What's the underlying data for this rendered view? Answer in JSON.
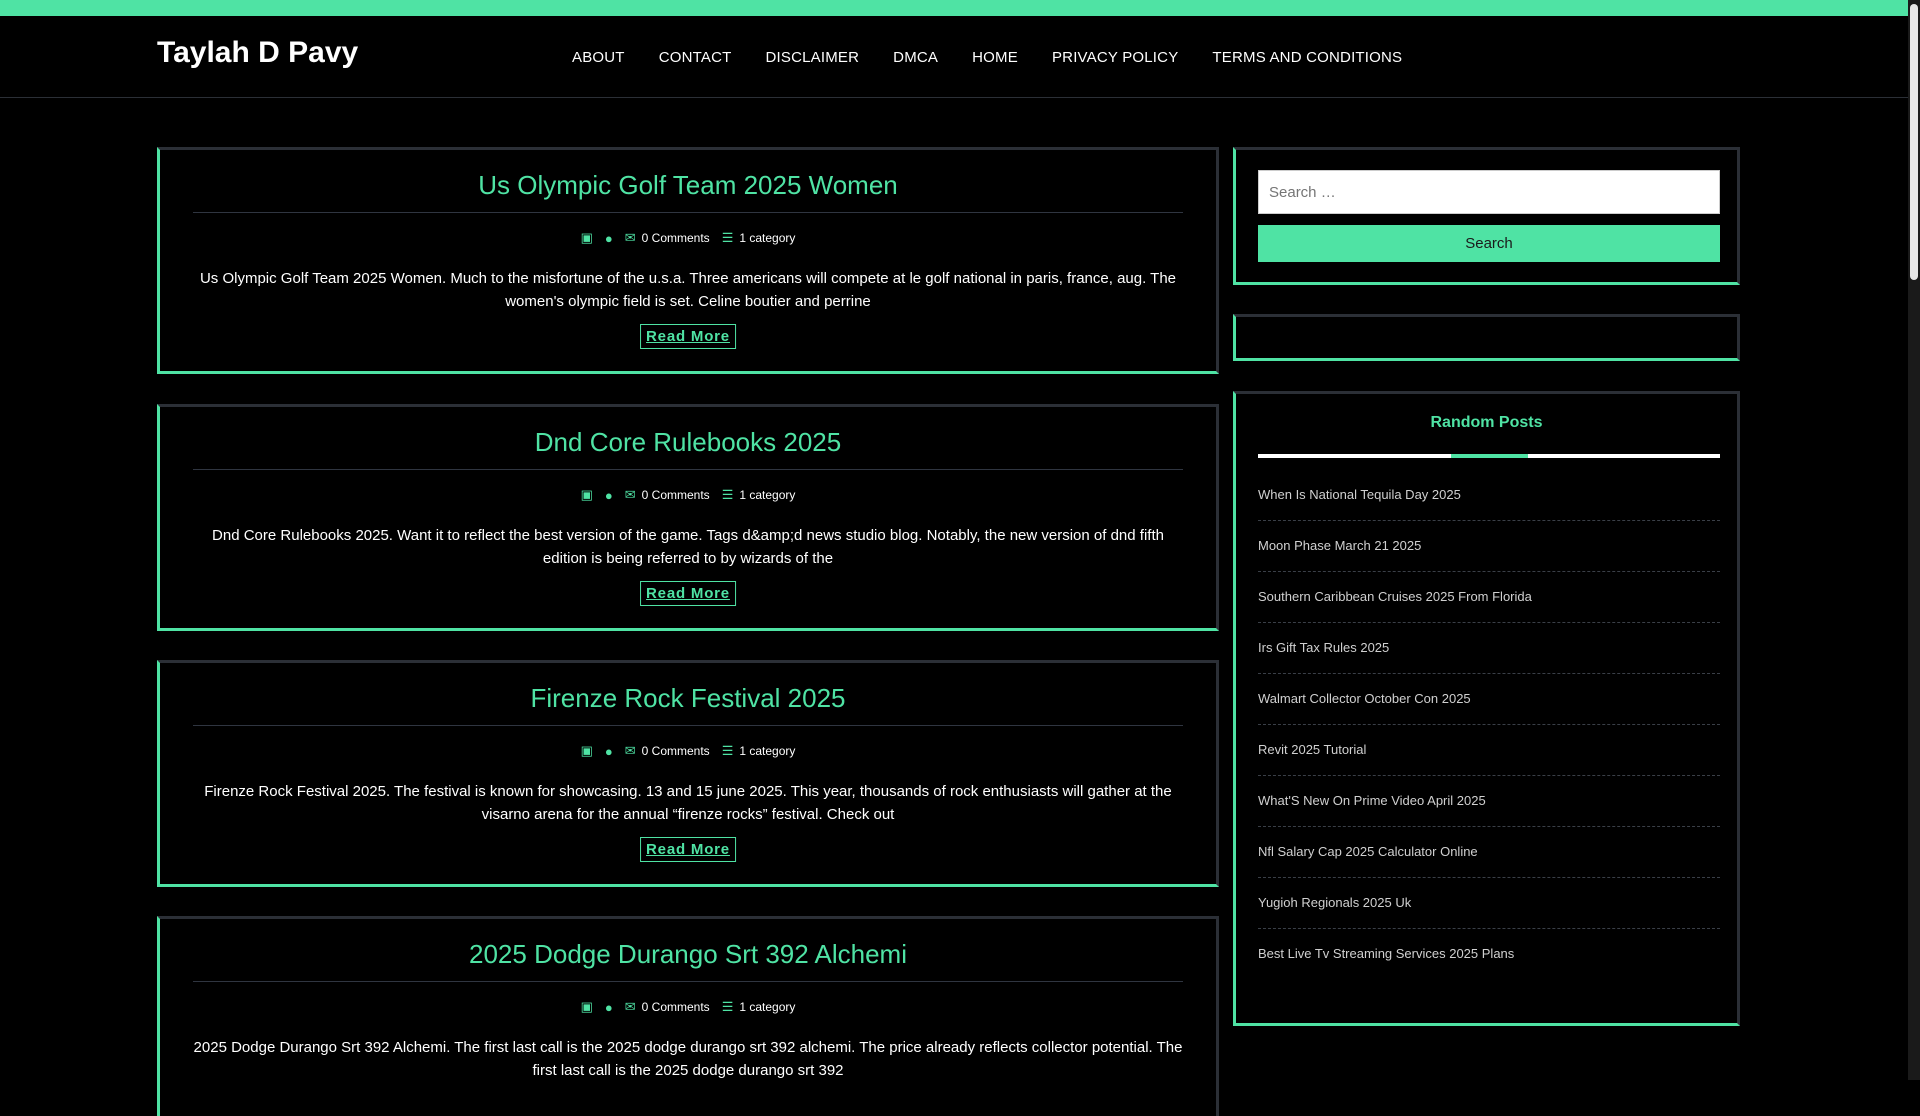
{
  "site": {
    "brand": "Taylah D Pavy"
  },
  "nav": [
    "ABOUT",
    "CONTACT",
    "DISCLAIMER",
    "DMCA",
    "HOME",
    "PRIVACY POLICY",
    "TERMS AND CONDITIONS"
  ],
  "posts": [
    {
      "title": "Us Olympic Golf Team 2025 Women",
      "comments": "0 Comments",
      "category": "1 category",
      "excerpt": "Us Olympic Golf Team 2025 Women. Much to the misfortune of the u.s.a. Three americans will compete at le golf national in paris, france, aug. The women's olympic field is set. Celine boutier and perrine",
      "read_more": "Read More"
    },
    {
      "title": "Dnd Core Rulebooks 2025",
      "comments": "0 Comments",
      "category": "1 category",
      "excerpt": "Dnd Core Rulebooks 2025. Want it to reflect the best version of the game. Tags d&amp;d news studio blog. Notably, the new version of dnd fifth edition is being referred to by wizards of the",
      "read_more": "Read More"
    },
    {
      "title": "Firenze Rock Festival 2025",
      "comments": "0 Comments",
      "category": "1 category",
      "excerpt": "Firenze Rock Festival 2025. The festival is known for showcasing. 13 and 15 june 2025. This year, thousands of rock enthusiasts will gather at the visarno arena for the annual “firenze rocks” festival. Check out",
      "read_more": "Read More"
    },
    {
      "title": "2025 Dodge Durango Srt 392 Alchemi",
      "comments": "0 Comments",
      "category": "1 category",
      "excerpt": "2025 Dodge Durango Srt 392 Alchemi. The first last call is the 2025 dodge durango srt 392 alchemi. The price already reflects collector potential. The first last call is the 2025 dodge durango srt 392",
      "read_more": "Read More"
    }
  ],
  "sidebar": {
    "search_placeholder": "Search …",
    "search_button": "Search",
    "random_posts_title": "Random Posts",
    "random_posts": [
      "When Is National Tequila Day 2025",
      "Moon Phase March 21 2025",
      "Southern Caribbean Cruises 2025 From Florida",
      "Irs Gift Tax Rules 2025",
      "Walmart Collector October Con 2025",
      "Revit 2025 Tutorial",
      "What'S New On Prime Video April 2025",
      "Nfl Salary Cap 2025 Calculator Online",
      "Yugioh Regionals 2025 Uk",
      "Best Live Tv Streaming Services 2025 Plans"
    ]
  },
  "colors": {
    "accent": "#4fe3a4",
    "background": "#000000",
    "border": "#2b2f36"
  },
  "icons": {
    "date": "calendar-icon",
    "author": "user-icon",
    "comments": "comments-icon",
    "category": "list-icon"
  }
}
